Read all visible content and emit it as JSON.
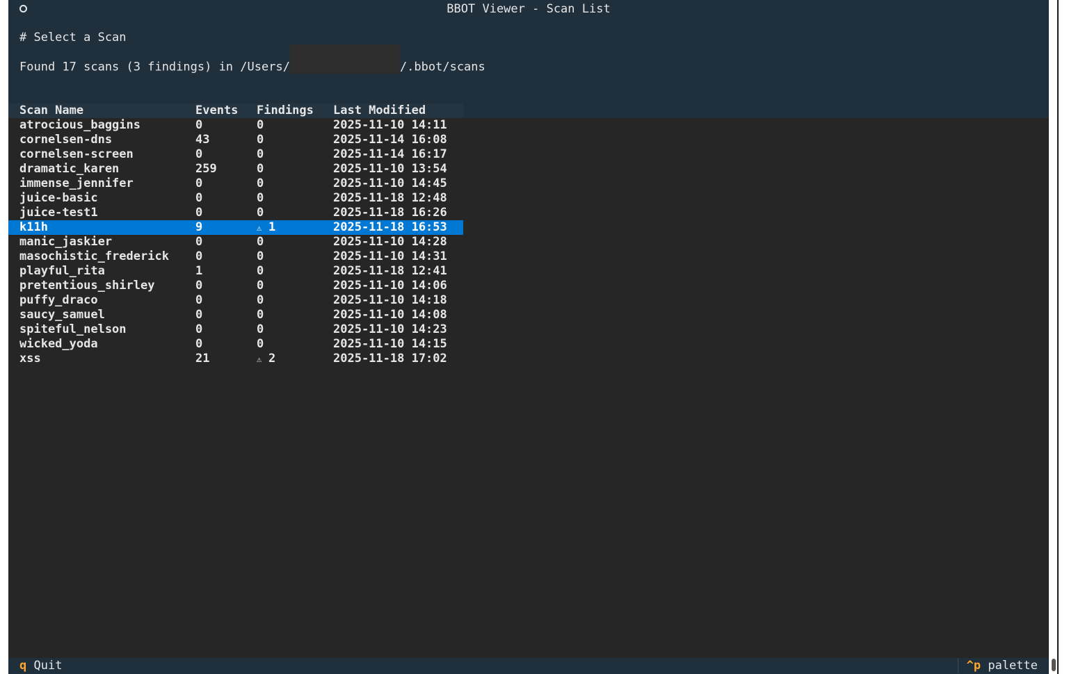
{
  "window": {
    "title": "BBOT Viewer - Scan List"
  },
  "page": {
    "heading": "# Select a Scan",
    "found_prefix": "Found 17 scans (3 findings) in /Users/",
    "found_suffix": "/.bbot/scans"
  },
  "table": {
    "columns": {
      "name": "Scan Name",
      "events": "Events",
      "findings": "Findings",
      "modified": "Last Modified"
    },
    "warning_icon": "warning-triangle-icon",
    "warning_glyph": "⚠",
    "selected_index": 7,
    "rows": [
      {
        "name": "atrocious_baggins",
        "events": "0",
        "findings": "0",
        "warn": false,
        "modified": "2025-11-10 14:11"
      },
      {
        "name": "cornelsen-dns",
        "events": "43",
        "findings": "0",
        "warn": false,
        "modified": "2025-11-14 16:08"
      },
      {
        "name": "cornelsen-screen",
        "events": "0",
        "findings": "0",
        "warn": false,
        "modified": "2025-11-14 16:17"
      },
      {
        "name": "dramatic_karen",
        "events": "259",
        "findings": "0",
        "warn": false,
        "modified": "2025-11-10 13:54"
      },
      {
        "name": "immense_jennifer",
        "events": "0",
        "findings": "0",
        "warn": false,
        "modified": "2025-11-10 14:45"
      },
      {
        "name": "juice-basic",
        "events": "0",
        "findings": "0",
        "warn": false,
        "modified": "2025-11-18 12:48"
      },
      {
        "name": "juice-test1",
        "events": "0",
        "findings": "0",
        "warn": false,
        "modified": "2025-11-18 16:26"
      },
      {
        "name": "k11h",
        "events": "9",
        "findings": "1",
        "warn": true,
        "modified": "2025-11-18 16:53"
      },
      {
        "name": "manic_jaskier",
        "events": "0",
        "findings": "0",
        "warn": false,
        "modified": "2025-11-10 14:28"
      },
      {
        "name": "masochistic_frederick",
        "events": "0",
        "findings": "0",
        "warn": false,
        "modified": "2025-11-10 14:31"
      },
      {
        "name": "playful_rita",
        "events": "1",
        "findings": "0",
        "warn": false,
        "modified": "2025-11-18 12:41"
      },
      {
        "name": "pretentious_shirley",
        "events": "0",
        "findings": "0",
        "warn": false,
        "modified": "2025-11-10 14:06"
      },
      {
        "name": "puffy_draco",
        "events": "0",
        "findings": "0",
        "warn": false,
        "modified": "2025-11-10 14:18"
      },
      {
        "name": "saucy_samuel",
        "events": "0",
        "findings": "0",
        "warn": false,
        "modified": "2025-11-10 14:08"
      },
      {
        "name": "spiteful_nelson",
        "events": "0",
        "findings": "0",
        "warn": false,
        "modified": "2025-11-10 14:23"
      },
      {
        "name": "wicked_yoda",
        "events": "0",
        "findings": "0",
        "warn": false,
        "modified": "2025-11-10 14:15"
      },
      {
        "name": "xss",
        "events": "21",
        "findings": "2",
        "warn": true,
        "modified": "2025-11-18 17:02"
      }
    ]
  },
  "footer": {
    "quit_key": "q",
    "quit_label": "Quit",
    "palette_key": "^p",
    "palette_label": "palette"
  },
  "colors": {
    "background": "#262626",
    "header_background": "#1f2f3c",
    "selection": "#0178d4",
    "footer_key": "#ffa62b"
  }
}
